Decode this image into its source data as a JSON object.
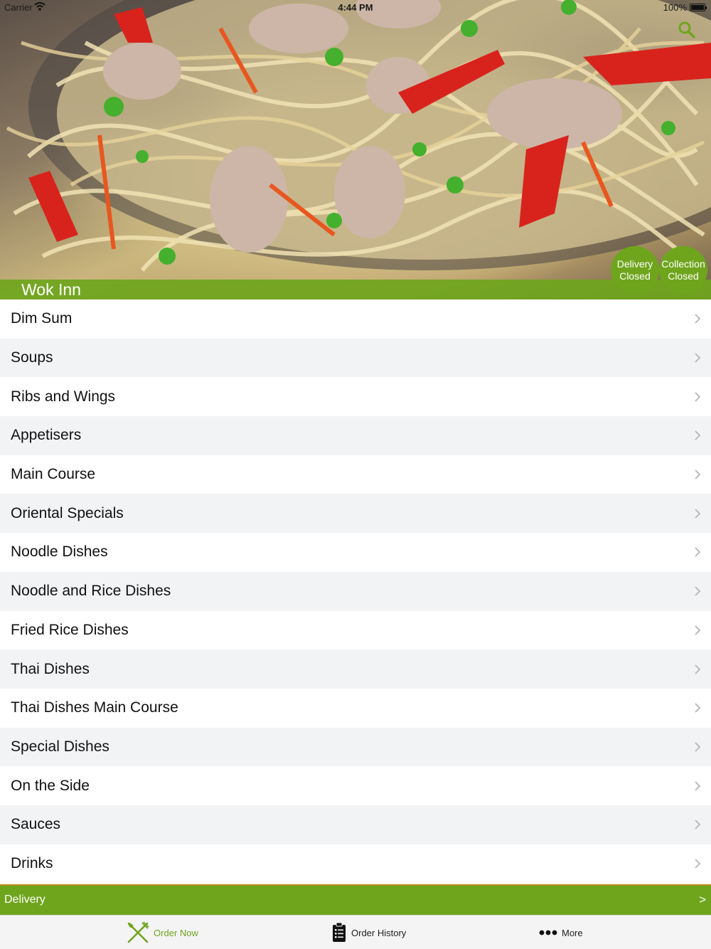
{
  "status_bar": {
    "carrier": "Carrier",
    "time": "4:44 PM",
    "battery": "100%"
  },
  "restaurant": {
    "name": "Wok Inn"
  },
  "badges": {
    "delivery": {
      "line1": "Delivery",
      "line2": "Closed"
    },
    "collection": {
      "line1": "Collection",
      "line2": "Closed"
    }
  },
  "menu": {
    "items": [
      {
        "label": "Dim Sum"
      },
      {
        "label": "Soups"
      },
      {
        "label": "Ribs and Wings"
      },
      {
        "label": "Appetisers"
      },
      {
        "label": "Main Course"
      },
      {
        "label": "Oriental Specials"
      },
      {
        "label": "Noodle Dishes"
      },
      {
        "label": "Noodle and Rice Dishes"
      },
      {
        "label": "Fried Rice Dishes"
      },
      {
        "label": "Thai Dishes"
      },
      {
        "label": "Thai Dishes Main Course"
      },
      {
        "label": "Special Dishes"
      },
      {
        "label": "On the Side"
      },
      {
        "label": "Sauces"
      },
      {
        "label": "Drinks"
      }
    ]
  },
  "delivery_bar": {
    "label": "Delivery",
    "arrow": ">"
  },
  "tabs": {
    "order_now": "Order Now",
    "order_history": "Order History",
    "more": "More"
  },
  "colors": {
    "accent": "#6fa51d",
    "row_alt": "#f2f3f5",
    "delivery_border": "#b58f1c"
  },
  "icons": {
    "search": "search-icon",
    "chevron": "chevron-right-icon",
    "order_now": "fork-knife-icon",
    "order_history": "clipboard-icon",
    "more": "ellipsis-icon",
    "wifi": "wifi-icon",
    "battery": "battery-icon"
  }
}
